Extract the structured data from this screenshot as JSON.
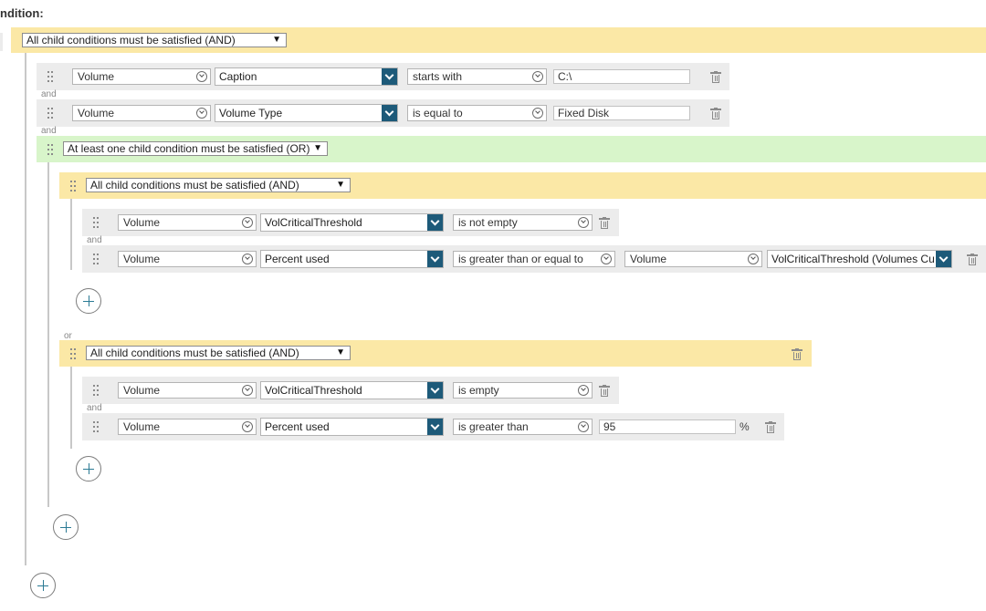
{
  "header": {
    "title": "ndition:"
  },
  "connectors": {
    "and": "and",
    "or": "or"
  },
  "groups": {
    "root": {
      "label": "All child conditions must be satisfied (AND)"
    },
    "or_group": {
      "label": "At least one child condition must be satisfied (OR)"
    },
    "and_group_1": {
      "label": "All child conditions must be satisfied (AND)"
    },
    "and_group_2": {
      "label": "All child conditions must be satisfied (AND)"
    }
  },
  "conditions": [
    {
      "object": "Volume",
      "field": "Caption",
      "operator": "starts with",
      "value": "C:\\"
    },
    {
      "object": "Volume",
      "field": "Volume Type",
      "operator": "is equal to",
      "value": "Fixed Disk"
    },
    {
      "object": "Volume",
      "field": "VolCriticalThreshold",
      "operator": "is not empty"
    },
    {
      "object": "Volume",
      "field": "Percent used",
      "operator": "is greater than or equal to",
      "compare_object": "Volume",
      "compare_field": "VolCriticalThreshold (Volumes Cu"
    },
    {
      "object": "Volume",
      "field": "VolCriticalThreshold",
      "operator": "is empty"
    },
    {
      "object": "Volume",
      "field": "Percent used",
      "operator": "is greater than",
      "value": "95",
      "unit": "%"
    }
  ],
  "icons": {
    "grip": "drag-handle-icon",
    "trash": "trash-icon",
    "add": "plus-icon",
    "dropdown": "chevron-down-icon"
  },
  "colors": {
    "and_band": "#fbe8a6",
    "or_band": "#d8f5ca",
    "row_bg": "#ececec",
    "field_button": "#1d5a79",
    "tree_line": "#c8c8c8"
  }
}
